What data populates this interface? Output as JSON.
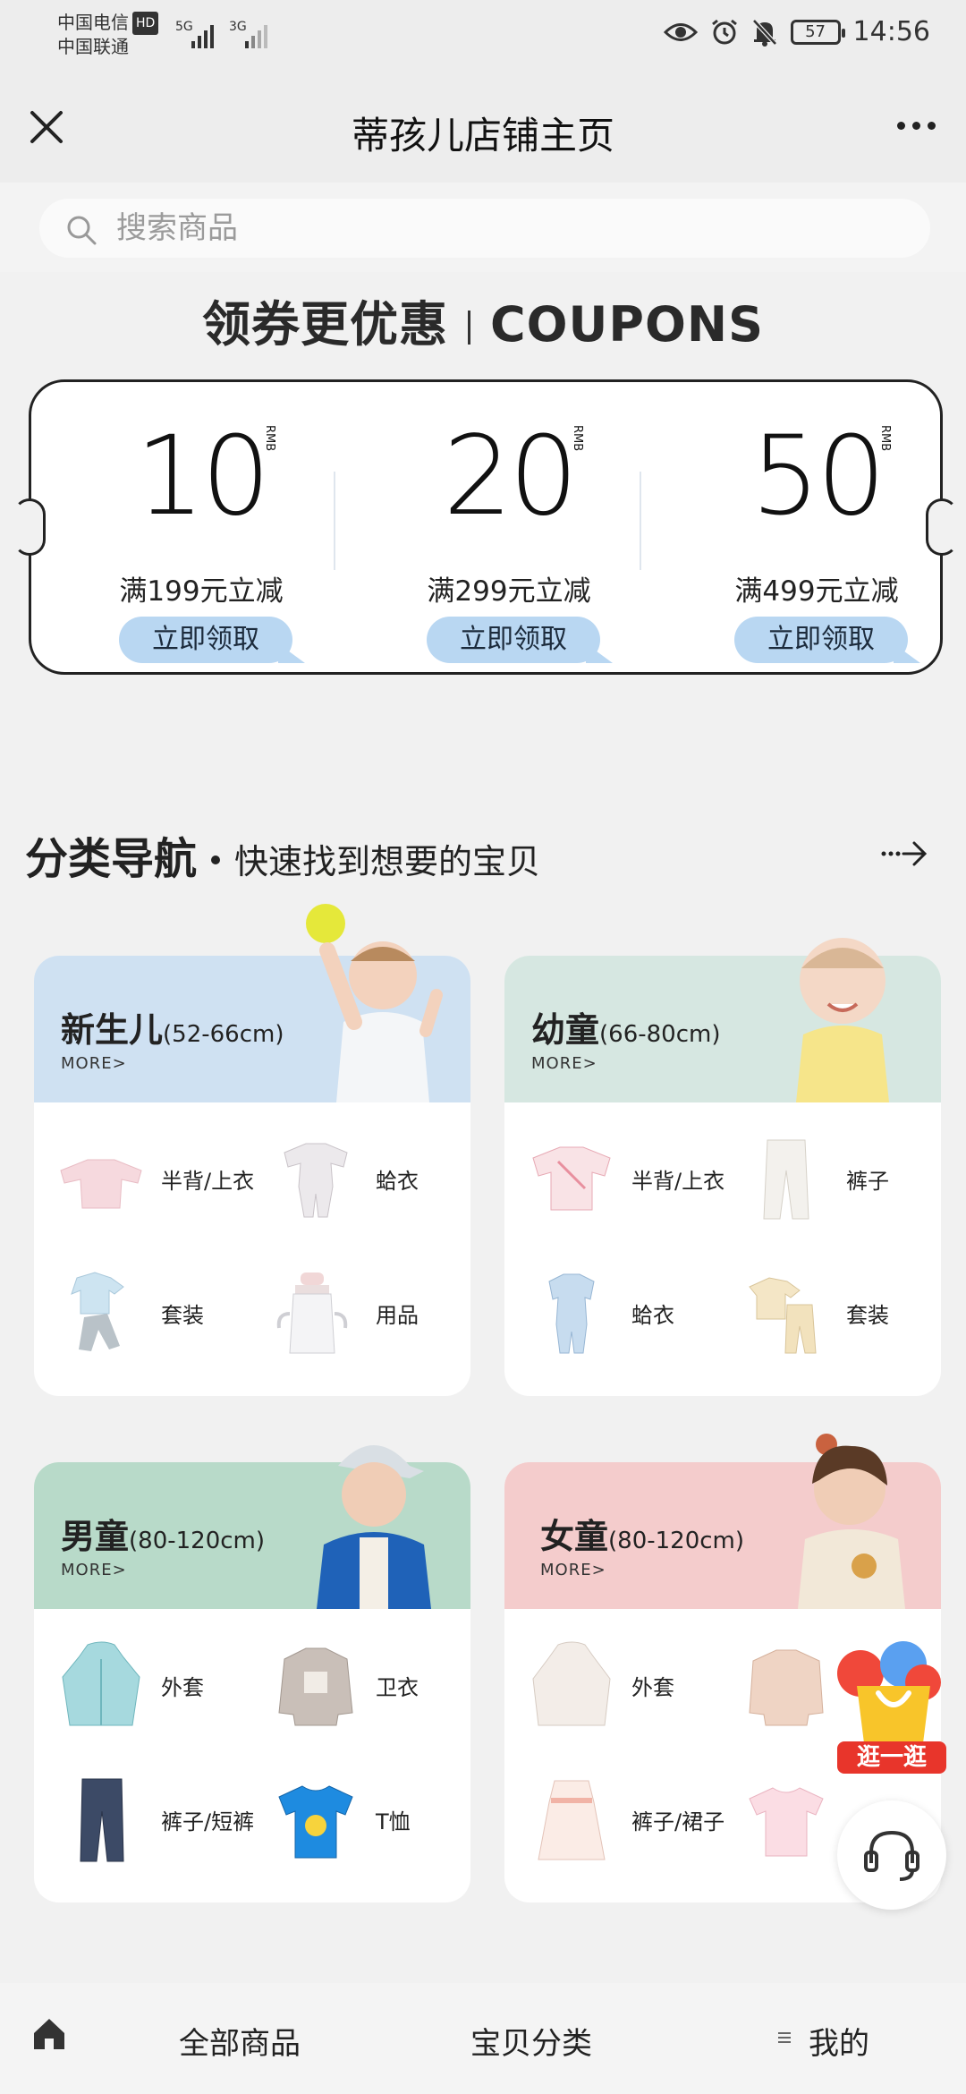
{
  "status_bar": {
    "carrier1": "中国电信",
    "hd_badge": "HD",
    "carrier2": "中国联通",
    "signal1_label": "5G",
    "signal2_label": "3G",
    "battery": "57",
    "time": "14:56"
  },
  "navbar": {
    "title": "蒂孩儿店铺主页"
  },
  "search": {
    "placeholder": "搜索商品"
  },
  "coupons": {
    "heading_cn": "领券更优惠",
    "heading_en": "COUPONS",
    "unit": "RMB",
    "items": [
      {
        "amount": "10",
        "condition": "满199元立减",
        "button": "立即领取"
      },
      {
        "amount": "20",
        "condition": "满299元立减",
        "button": "立即领取"
      },
      {
        "amount": "50",
        "condition": "满499元立减",
        "button": "立即领取"
      }
    ]
  },
  "category_nav": {
    "title": "分类导航",
    "subtitle": "快速找到想要的宝贝",
    "more_label": "MORE>",
    "cards": [
      {
        "name": "新生儿",
        "range": "(52-66cm)",
        "color": "#cfe1f2",
        "items": [
          "半背/上衣",
          "蛤衣",
          "套装",
          "用品"
        ]
      },
      {
        "name": "幼童",
        "range": "(66-80cm)",
        "color": "#d6e7e1",
        "items": [
          "半背/上衣",
          "裤子",
          "蛤衣",
          "套装"
        ]
      },
      {
        "name": "男童",
        "range": "(80-120cm)",
        "color": "#b8dac9",
        "items": [
          "外套",
          "卫衣",
          "裤子/短裤",
          "T恤"
        ]
      },
      {
        "name": "女童",
        "range": "(80-120cm)",
        "color": "#f4cccc",
        "items": [
          "外套",
          "",
          "裤子/裙子",
          ""
        ]
      }
    ]
  },
  "floating": {
    "stroll_label": "逛一逛"
  },
  "tabbar": {
    "all_products": "全部商品",
    "categories": "宝贝分类",
    "mine": "我的"
  },
  "colors": {
    "coupon_button": "#b9d7f2",
    "stroll_red": "#e8352b"
  }
}
